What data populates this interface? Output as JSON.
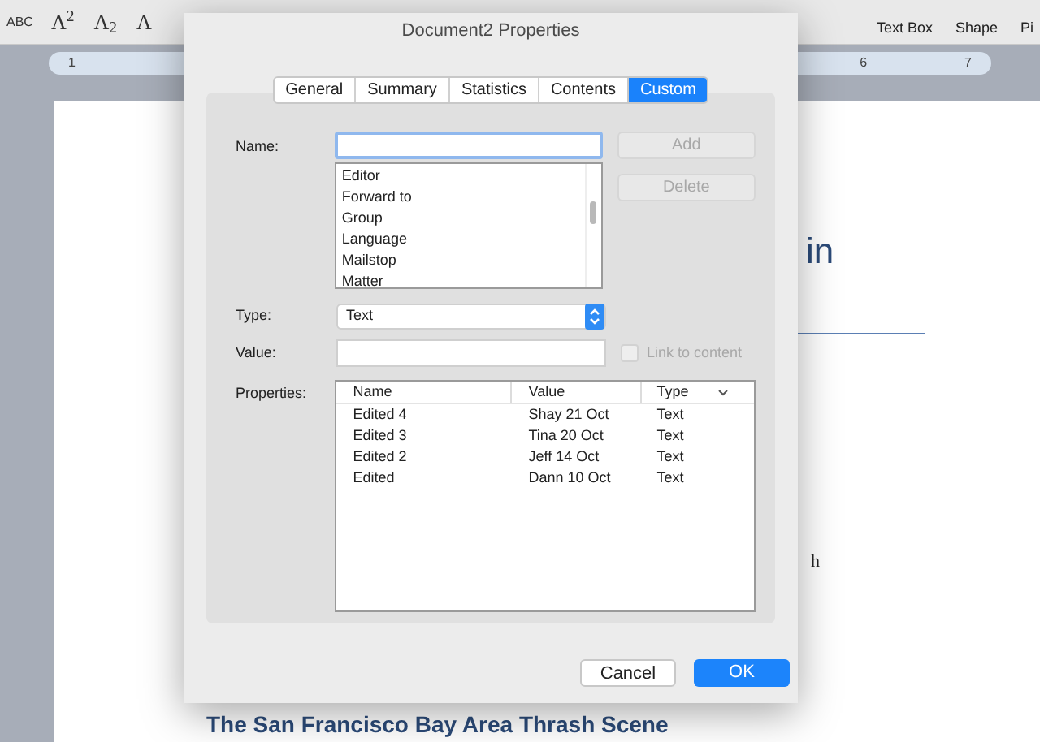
{
  "toolbar": {
    "format_buttons": [
      "ABC",
      "A$^{2}$",
      "A$_{2}$",
      "A"
    ],
    "insert_buttons": [
      {
        "label": "Text Box"
      },
      {
        "label": "Shape"
      },
      {
        "label": "Pi"
      }
    ]
  },
  "ruler": {
    "labels": [
      "1",
      "6",
      "7"
    ]
  },
  "document": {
    "heading_fragment": "in",
    "text_fragment": "h",
    "heading": "The San Francisco Bay Area Thrash Scene"
  },
  "dialog": {
    "title": "Document2 Properties",
    "tabs": [
      {
        "label": "General",
        "selected": false
      },
      {
        "label": "Summary",
        "selected": false
      },
      {
        "label": "Statistics",
        "selected": false
      },
      {
        "label": "Contents",
        "selected": false
      },
      {
        "label": "Custom",
        "selected": true
      }
    ],
    "name_label": "Name:",
    "name_list": [
      "Editor",
      "Forward to",
      "Group",
      "Language",
      "Mailstop",
      "Matter"
    ],
    "side_buttons": [
      {
        "label": "Add",
        "disabled": true
      },
      {
        "label": "Delete",
        "disabled": true
      }
    ],
    "type_label": "Type:",
    "type_value": "Text",
    "value_label": "Value:",
    "link_checkbox": {
      "label": "Link to content",
      "checked": false,
      "disabled": true
    },
    "properties_label": "Properties:",
    "columns": [
      "Name",
      "Value",
      "Type"
    ],
    "rows": [
      [
        "Edited 4",
        "Shay 21 Oct",
        "Text"
      ],
      [
        "Edited 3",
        "Tina 20 Oct",
        "Text"
      ],
      [
        "Edited 2",
        "Jeff 14 Oct",
        "Text"
      ],
      [
        "Edited",
        "Dann 10 Oct",
        "Text"
      ]
    ],
    "footer_buttons": [
      {
        "label": "Cancel",
        "kind": "secondary"
      },
      {
        "label": "OK",
        "kind": "primary"
      }
    ]
  }
}
